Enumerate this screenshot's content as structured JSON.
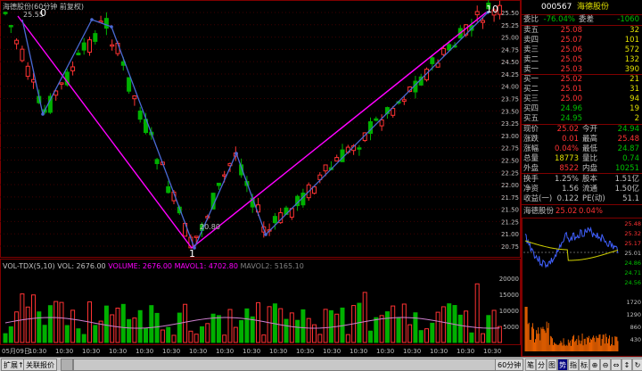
{
  "header": {
    "title": "海德股份(60分钟 前复权)",
    "top_price_label": "25.55",
    "low_price_label": "20.80"
  },
  "wave_labels": [
    {
      "text": "0",
      "color": "#ffffff"
    },
    {
      "text": "10",
      "color": "#ffffff"
    },
    {
      "text": "1",
      "color": "#ffffff"
    }
  ],
  "price_axis": [
    "25.50",
    "25.25",
    "25.00",
    "24.75",
    "24.50",
    "24.25",
    "24.00",
    "23.75",
    "23.50",
    "23.25",
    "23.00",
    "22.75",
    "22.50",
    "22.25",
    "22.00",
    "21.75",
    "21.50",
    "21.25",
    "21.00",
    "20.75"
  ],
  "volume_header": {
    "name": "VOL-TDX(5,10)",
    "vol": "VOL: 2676.00",
    "volume": "VOLUME: 2676.00",
    "mavol1": "MAVOL1: 4702.80",
    "mavol2": "MAVOL2: 5165.10"
  },
  "volume_axis": [
    "20000",
    "15000",
    "10000",
    "5000"
  ],
  "time_axis": [
    "05月09日",
    "10:30",
    "10:30",
    "10:30",
    "10:30",
    "10:30",
    "10:30",
    "10:30",
    "10:30",
    "10:30",
    "10:30",
    "10:30",
    "10:30",
    "10:30",
    "10:30",
    "10:30",
    "10:30",
    "10:30",
    "10:30"
  ],
  "colors": {
    "up": "#ff3232",
    "down": "#00b000",
    "wave": "#ff00ff",
    "trend": "#4a6ad6",
    "ma": "#d080d0"
  },
  "panel": {
    "code": "000567",
    "name": "海德股份",
    "weibi_label": "委比",
    "weibi_value": "-76.04%",
    "weicha_label": "委差",
    "weicha_value": "-1060",
    "asks": [
      {
        "label": "卖五",
        "price": "25.08",
        "vol": "32"
      },
      {
        "label": "卖四",
        "price": "25.07",
        "vol": "101"
      },
      {
        "label": "卖三",
        "price": "25.06",
        "vol": "572"
      },
      {
        "label": "卖二",
        "price": "25.05",
        "vol": "132"
      },
      {
        "label": "卖一",
        "price": "25.03",
        "vol": "390"
      }
    ],
    "bids": [
      {
        "label": "买一",
        "price": "25.02",
        "vol": "21"
      },
      {
        "label": "买二",
        "price": "25.01",
        "vol": "31"
      },
      {
        "label": "买三",
        "price": "25.00",
        "vol": "94"
      },
      {
        "label": "买四",
        "price": "24.96",
        "vol": "19"
      },
      {
        "label": "买五",
        "price": "24.95",
        "vol": "2"
      }
    ],
    "stats": [
      {
        "l1": "现价",
        "v1": "25.02",
        "c1": "#ff3232",
        "l2": "今开",
        "v2": "24.94",
        "c2": "#00c000"
      },
      {
        "l1": "涨跌",
        "v1": "0.01",
        "c1": "#ff3232",
        "l2": "最高",
        "v2": "25.48",
        "c2": "#ff3232"
      },
      {
        "l1": "涨幅",
        "v1": "0.04%",
        "c1": "#ff3232",
        "l2": "最低",
        "v2": "24.87",
        "c2": "#00c000"
      },
      {
        "l1": "总量",
        "v1": "18773",
        "c1": "#e0e000",
        "l2": "量比",
        "v2": "0.74",
        "c2": "#00c000"
      },
      {
        "l1": "外盘",
        "v1": "8522",
        "c1": "#ff3232",
        "l2": "内盘",
        "v2": "10251",
        "c2": "#00c000"
      }
    ],
    "stats2": [
      {
        "l1": "换手",
        "v1": "1.25%",
        "l2": "股本",
        "v2": "1.51亿"
      },
      {
        "l1": "净资",
        "v1": "1.56",
        "l2": "流通",
        "v2": "1.50亿"
      },
      {
        "l1": "收益(一)",
        "v1": "0.122",
        "l2": "PE(动)",
        "v2": "51.1"
      }
    ],
    "mini_title": "海德股份",
    "mini_price": "25.02",
    "mini_pct": "0.04%",
    "mini_axis": [
      "25.48",
      "25.32",
      "25.17",
      "25.01",
      "24.86",
      "24.71",
      "24.56"
    ],
    "mini_vol_axis": [
      "1720",
      "1290",
      "860",
      "430"
    ]
  },
  "bottom": {
    "tab1": "扩展↑",
    "tab2": "关联报价",
    "tab3": "60分钟",
    "buttons": [
      "笔",
      "分",
      "图",
      "势",
      "指",
      "标",
      "⊕",
      "⊖",
      "⇔",
      "↕",
      "↻"
    ]
  }
}
